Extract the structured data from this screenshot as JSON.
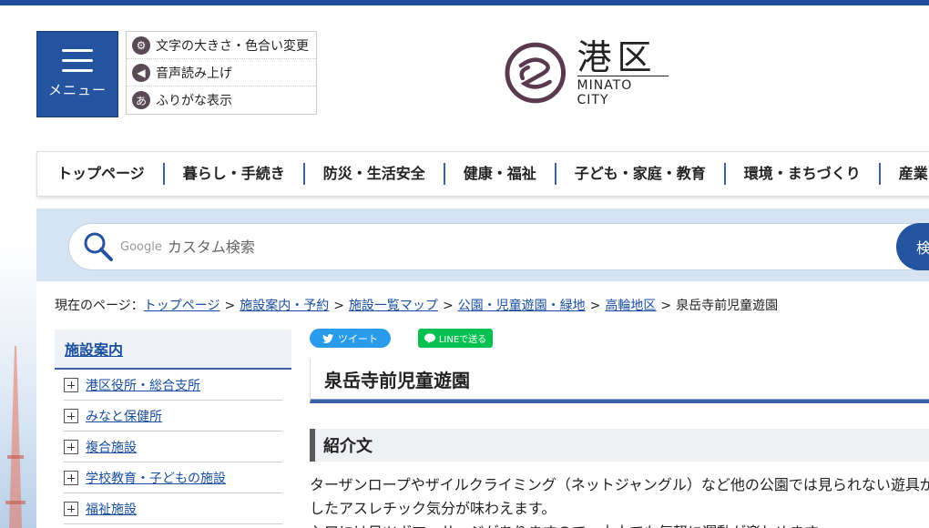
{
  "header": {
    "menu_label": "メニュー",
    "tools": [
      {
        "icon": "gear-icon",
        "label": "文字の大きさ・色合い変更"
      },
      {
        "icon": "speaker-icon",
        "label": "音声読み上げ"
      },
      {
        "icon": "hiragana-a-icon",
        "label": "ふりがな表示"
      }
    ],
    "logo": {
      "ku": "港区",
      "city": "MINATO CITY"
    }
  },
  "nav": [
    "トップページ",
    "暮らし・手続き",
    "防災・生活安全",
    "健康・福祉",
    "子ども・家庭・教育",
    "環境・まちづくり",
    "産業・"
  ],
  "search": {
    "google": "Google",
    "placeholder": "カスタム検索",
    "button": "検"
  },
  "breadcrumb": {
    "prefix": "現在のページ：",
    "links": [
      "トップページ",
      "施設案内・予約",
      "施設一覧マップ",
      "公園・児童遊園・緑地",
      "高輪地区"
    ],
    "current": "泉岳寺前児童遊園"
  },
  "side": {
    "title": "施設案内",
    "items": [
      "港区役所・総合支所",
      "みなと保健所",
      "複合施設",
      "学校教育・子どもの施設",
      "福祉施設"
    ]
  },
  "social": {
    "tweet": "ツイート",
    "line": "LINEで送る"
  },
  "main": {
    "title": "泉岳寺前児童遊園",
    "section": "紹介文",
    "lines": [
      "ターザンロープやザイルクライミング（ネットジャングル）など他の公園では見られない遊具が",
      "したアスレチック気分が味わえます。",
      "入口には日ツボマッサージがありますので、大人でも気軽に運動が楽しめます。"
    ]
  },
  "colors": {
    "brand": "#24549f",
    "accent": "#3b62a8",
    "logo": "#5a3a4f"
  }
}
